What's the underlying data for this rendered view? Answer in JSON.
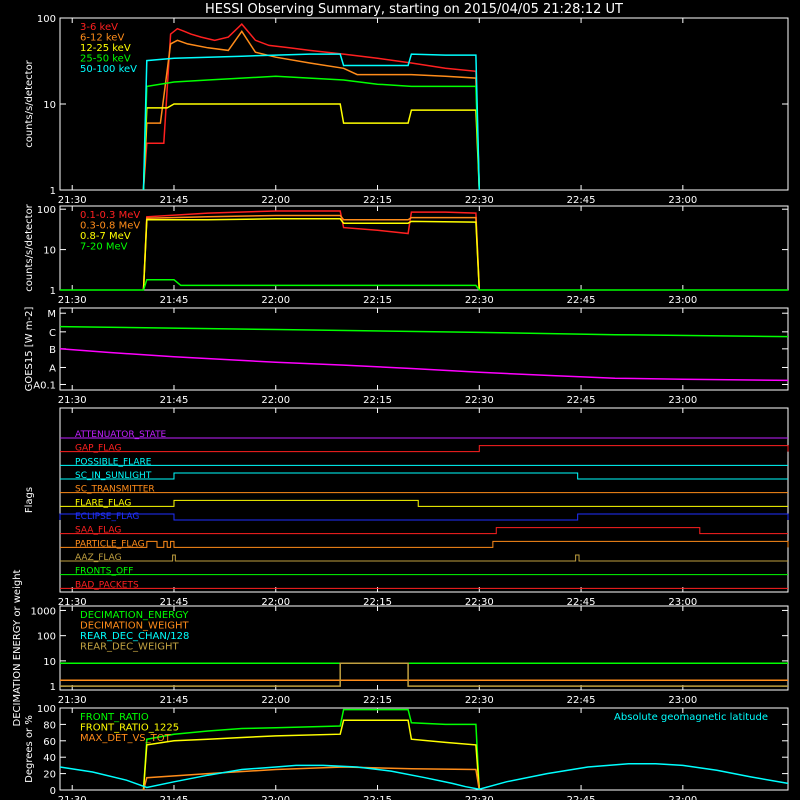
{
  "title": "HESSI Observing Summary, starting on 2015/04/05 21:28:12 UT",
  "colors": {
    "bg": "#000000",
    "axis": "#ffffff",
    "red": "#ff2020",
    "orange": "#ff8c1a",
    "yellow": "#ffff00",
    "green": "#00ff00",
    "cyan": "#00ffff",
    "magenta": "#ff00ff",
    "blue": "#2030ff",
    "purple": "#c020ff",
    "flag_orange": "#ff8c1a",
    "flag_olive": "#c0a040"
  },
  "x_axis": {
    "ticks": [
      "21:30",
      "21:45",
      "22:00",
      "22:15",
      "22:30",
      "22:45",
      "23:00"
    ],
    "tick_minutes": [
      30,
      45,
      60,
      75,
      90,
      105,
      120
    ],
    "range_minutes": [
      28.2,
      135.5
    ]
  },
  "chart_data": [
    {
      "type": "line",
      "ylabel": "counts/s/detector",
      "scale": "log",
      "ylim": [
        1,
        100
      ],
      "yticks": [
        "1",
        "10",
        "100"
      ],
      "ytick_values": [
        1,
        10,
        100
      ],
      "legend_position": "top-left",
      "series": [
        {
          "name": "3-6 keV",
          "color": "#ff2020",
          "x": [
            40.5,
            41.0,
            42.0,
            43.5,
            44.5,
            45.5,
            46.5,
            47.5,
            49,
            51,
            53,
            55,
            57,
            59,
            62,
            65,
            70,
            75,
            80,
            85,
            89.5,
            90.0
          ],
          "y": [
            1,
            3.5,
            3.5,
            3.5,
            65,
            75,
            70,
            65,
            60,
            55,
            60,
            85,
            55,
            48,
            45,
            42,
            38,
            34,
            30,
            26,
            24,
            1
          ]
        },
        {
          "name": "6-12 keV",
          "color": "#ff8c1a",
          "x": [
            40.5,
            41.0,
            43.0,
            44.5,
            45.5,
            47,
            50,
            53,
            55,
            57,
            60,
            65,
            70,
            72,
            75,
            80,
            85,
            89.5,
            90.0
          ],
          "y": [
            1,
            6,
            6,
            50,
            55,
            50,
            45,
            42,
            70,
            40,
            35,
            30,
            26,
            22,
            22,
            22,
            21,
            20,
            1
          ]
        },
        {
          "name": "12-25 keV",
          "color": "#ffff00",
          "x": [
            40.5,
            41.0,
            44.0,
            45.0,
            50,
            55,
            60,
            65,
            69.5,
            70,
            75,
            79.5,
            80,
            85,
            89.5,
            90.0
          ],
          "y": [
            1,
            9,
            9,
            10,
            10,
            10,
            10,
            10,
            10,
            6,
            6,
            6,
            8.5,
            8.5,
            8.5,
            1
          ]
        },
        {
          "name": "25-50 keV",
          "color": "#00ff00",
          "x": [
            40.5,
            41.0,
            45,
            50,
            55,
            60,
            65,
            70,
            75,
            80,
            85,
            89.5,
            90.0
          ],
          "y": [
            1,
            16,
            18,
            19,
            20,
            21,
            20,
            19,
            17,
            16,
            16,
            16,
            1
          ]
        },
        {
          "name": "50-100 keV",
          "color": "#00ffff",
          "x": [
            40.5,
            41.0,
            45,
            50,
            55,
            60,
            65,
            69.5,
            70,
            75,
            79.5,
            80,
            85,
            89.5,
            90.0
          ],
          "y": [
            1,
            32,
            34,
            35,
            36,
            37,
            38,
            38,
            28,
            28,
            28,
            38,
            37,
            37,
            1
          ]
        }
      ]
    },
    {
      "type": "line",
      "ylabel": "counts/s/detector",
      "scale": "log",
      "ylim": [
        1,
        120
      ],
      "yticks": [
        "1",
        "10",
        "100"
      ],
      "ytick_values": [
        1,
        10,
        100
      ],
      "legend_position": "top-left",
      "series": [
        {
          "name": "0.1-0.3 MeV",
          "color": "#ff2020",
          "x": [
            40.5,
            41.0,
            50,
            60,
            69.5,
            70,
            75,
            79.5,
            80,
            85,
            89.5,
            90.0
          ],
          "y": [
            1,
            65,
            80,
            90,
            90,
            35,
            30,
            25,
            85,
            85,
            80,
            1
          ]
        },
        {
          "name": "0.3-0.8 MeV",
          "color": "#ff8c1a",
          "x": [
            40.5,
            41.0,
            50,
            60,
            69.5,
            70,
            79.5,
            80,
            89.5,
            90.0
          ],
          "y": [
            1,
            60,
            65,
            70,
            70,
            55,
            55,
            62,
            62,
            1
          ]
        },
        {
          "name": "0.8-7 MeV",
          "color": "#ffff00",
          "x": [
            40.5,
            41.0,
            50,
            60,
            69.5,
            70,
            79.5,
            80,
            89.5,
            90.0
          ],
          "y": [
            1,
            55,
            55,
            58,
            58,
            45,
            45,
            50,
            48,
            1
          ]
        },
        {
          "name": "7-20 MeV",
          "color": "#00ff00",
          "x": [
            28.2,
            40.5,
            41.0,
            45,
            46,
            89.5,
            90.0,
            135.5
          ],
          "y": [
            1,
            1,
            1.8,
            1.8,
            1.3,
            1.3,
            1,
            1
          ]
        }
      ]
    },
    {
      "type": "line",
      "ylabel": "GOES15 [W m-2]",
      "scale": "log",
      "ylim": [
        0.07,
        14
      ],
      "yticks": [
        "A0.1",
        "A",
        "B",
        "C",
        "M"
      ],
      "ytick_values": [
        0.1,
        0.3,
        1,
        3,
        10
      ],
      "series": [
        {
          "name": "",
          "color": "#00ff00",
          "x": [
            28.2,
            60,
            90,
            110,
            135.5
          ],
          "y": [
            4.2,
            3.5,
            2.9,
            2.5,
            2.2
          ]
        },
        {
          "name": "",
          "color": "#ff00ff",
          "x": [
            28.2,
            35,
            45,
            60,
            70,
            80,
            90,
            100,
            110,
            120,
            135.5
          ],
          "y": [
            1.0,
            0.8,
            0.6,
            0.42,
            0.35,
            0.28,
            0.22,
            0.18,
            0.15,
            0.14,
            0.13
          ]
        }
      ]
    },
    {
      "type": "line",
      "ylabel": "Flags",
      "flags": [
        {
          "name": "ATTENUATOR_STATE",
          "color": "#c020ff",
          "segments": []
        },
        {
          "name": "GAP_FLAG",
          "color": "#ff2020",
          "segments": [
            [
              90,
              135.5
            ]
          ]
        },
        {
          "name": "POSSIBLE_FLARE",
          "color": "#00ffff",
          "segments": []
        },
        {
          "name": "SC_IN_SUNLIGHT",
          "color": "#00ffff",
          "segments": [
            [
              45,
              104.5
            ]
          ]
        },
        {
          "name": "SC_TRANSMITTER",
          "color": "#ff8c1a",
          "segments": []
        },
        {
          "name": "FLARE_FLAG",
          "color": "#ffff00",
          "segments": [
            [
              45,
              81
            ]
          ]
        },
        {
          "name": "ECLIPSE_FLAG",
          "color": "#2030ff",
          "segments": [
            [
              28.2,
              45
            ],
            [
              104.5,
              135.5
            ]
          ]
        },
        {
          "name": "SAA_FLAG",
          "color": "#ff2020",
          "segments": [
            [
              92.5,
              122.5
            ]
          ]
        },
        {
          "name": "PARTICLE_FLAG",
          "color": "#ff8c1a",
          "segments": [
            [
              41,
              42.5
            ],
            [
              43.5,
              44
            ],
            [
              44.5,
              45
            ],
            [
              92,
              135.5
            ]
          ]
        },
        {
          "name": "AAZ_FLAG",
          "color": "#c0a040",
          "segments": [
            [
              44.8,
              45.2
            ],
            [
              104.2,
              104.7
            ]
          ]
        },
        {
          "name": "FRONTS_OFF",
          "color": "#00ff00",
          "segments": []
        },
        {
          "name": "BAD_PACKETS",
          "color": "#ff2020",
          "segments": []
        }
      ]
    },
    {
      "type": "line",
      "ylabel": "DECIMATION ENERGY or weight",
      "scale": "log",
      "ylim": [
        0.7,
        1500
      ],
      "yticks": [
        "1",
        "10",
        "100",
        "1000"
      ],
      "ytick_values": [
        1,
        10,
        100,
        1000
      ],
      "legend_position": "top-left",
      "series": [
        {
          "name": "DECIMATION_ENERGY",
          "color": "#00ff00",
          "x": [
            28.2,
            135.5
          ],
          "y": [
            8,
            8
          ]
        },
        {
          "name": "DECIMATION_WEIGHT",
          "color": "#ff8c1a",
          "x": [
            28.2,
            69.5,
            69.5,
            79.5,
            79.5,
            135.5
          ],
          "y": [
            1.7,
            1.7,
            1.7,
            1.7,
            1.7,
            1.7
          ]
        },
        {
          "name": "REAR_DEC_CHAN/128",
          "color": "#00ffff",
          "x": [],
          "y": []
        },
        {
          "name": "REAR_DEC_WEIGHT",
          "color": "#c0a040",
          "x": [
            28.2,
            69.5,
            69.5,
            79.5,
            79.5,
            135.5
          ],
          "y": [
            1,
            1,
            8,
            8,
            1,
            1
          ]
        }
      ]
    },
    {
      "type": "line",
      "ylabel": "Degrees or %",
      "ylim": [
        0,
        100
      ],
      "yticks": [
        "0",
        "20",
        "40",
        "60",
        "80",
        "100"
      ],
      "ytick_values": [
        0,
        20,
        40,
        60,
        80,
        100
      ],
      "legend_position": "top-left",
      "annotation": "Absolute geomagnetic latitude",
      "series": [
        {
          "name": "FRONT_RATIO",
          "color": "#00ff00",
          "x": [
            40.5,
            41.0,
            45,
            50,
            55,
            60,
            69.5,
            70,
            79.5,
            80,
            85,
            89.5,
            90.0
          ],
          "y": [
            0,
            62,
            68,
            72,
            75,
            76,
            78,
            98,
            98,
            82,
            80,
            80,
            0
          ]
        },
        {
          "name": "FRONT_RATIO_1225",
          "color": "#ffff00",
          "x": [
            40.5,
            41.0,
            45,
            50,
            55,
            60,
            69.5,
            70,
            79.5,
            80,
            85,
            89.5,
            90.0
          ],
          "y": [
            0,
            55,
            60,
            62,
            64,
            66,
            68,
            85,
            85,
            62,
            58,
            55,
            0
          ]
        },
        {
          "name": "MAX_DET_VS_TOT",
          "color": "#ff8c1a",
          "x": [
            40.5,
            41.0,
            50,
            60,
            70,
            80,
            89.5,
            90.0
          ],
          "y": [
            0,
            15,
            20,
            25,
            28,
            26,
            25,
            0
          ]
        },
        {
          "name": "",
          "color": "#00ffff",
          "x": [
            28.2,
            33,
            38,
            41,
            45,
            50,
            55,
            60,
            63,
            67,
            72,
            77,
            82,
            86,
            88,
            90,
            94,
            100,
            106,
            112,
            116,
            120,
            125,
            130,
            135.5
          ],
          "y": [
            28,
            22,
            12,
            3,
            10,
            18,
            25,
            28,
            30,
            30,
            28,
            23,
            15,
            8,
            4,
            1,
            10,
            20,
            28,
            32,
            32,
            30,
            24,
            16,
            8
          ]
        }
      ]
    }
  ]
}
